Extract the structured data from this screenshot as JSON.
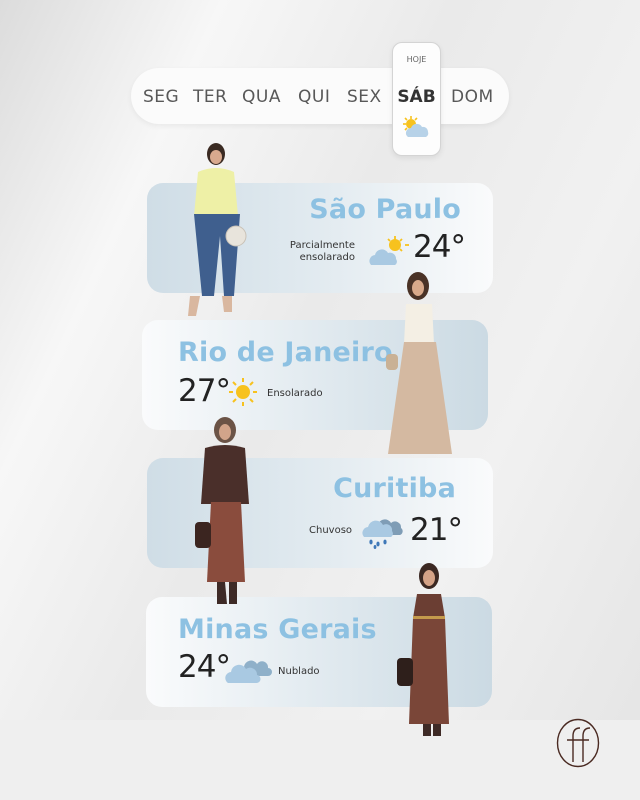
{
  "week": {
    "days": [
      "SEG",
      "TER",
      "QUA",
      "QUI",
      "SEX",
      "SÁB",
      "DOM"
    ],
    "today_label": "HOJE",
    "today_day": "SÁB",
    "today_icon": "partly-sunny-icon"
  },
  "cities": [
    {
      "name": "São Paulo",
      "temp": "24°",
      "condition": "Parcialmente ensolarado",
      "icon": "partly-sunny-icon"
    },
    {
      "name": "Rio de Janeiro",
      "temp": "27°",
      "condition": "Ensolarado",
      "icon": "sun-icon"
    },
    {
      "name": "Curitiba",
      "temp": "21°",
      "condition": "Chuvoso",
      "icon": "rain-cloud-icon"
    },
    {
      "name": "Minas Gerais",
      "temp": "24°",
      "condition": "Nublado",
      "icon": "cloud-icon"
    }
  ],
  "colors": {
    "city": "#8dc1e2",
    "sun": "#f7c21e",
    "cloud": "#a9c9e2"
  },
  "brand": {
    "logo": "ff-monogram-logo"
  }
}
